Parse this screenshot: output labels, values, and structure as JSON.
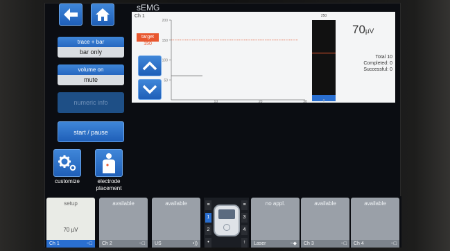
{
  "app": {
    "title": "sEMG"
  },
  "nav": {
    "back_icon": "back-arrow-icon",
    "home_icon": "home-icon"
  },
  "left": {
    "display_mode": {
      "option": "trace + bar",
      "value": "bar only"
    },
    "volume": {
      "option": "volume on",
      "value": "mute"
    },
    "numeric_info": "numeric info",
    "start_pause": "start / pause",
    "customize": "customize",
    "electrode_line1": "electrode",
    "electrode_line2": "placement"
  },
  "trace": {
    "channel": "Ch 1",
    "target_label": "target",
    "target_value": "150",
    "y_ticks": [
      "200",
      "150",
      "100",
      "50"
    ],
    "x_ticks": [
      "10",
      "20",
      "30"
    ],
    "bar_scale_top": "250",
    "bar_scale_bottom": "0"
  },
  "chart_data": {
    "type": "line",
    "series": [
      {
        "values": [
          60,
          60
        ]
      }
    ],
    "target": 150,
    "bar_level": 60,
    "ylim": [
      0,
      200
    ],
    "xlim": [
      0,
      30
    ]
  },
  "readout": {
    "value": "70",
    "unit": "µV",
    "total_label": "Total",
    "total": "10",
    "completed_label": "Completed:",
    "completed": "0",
    "successful_label": "Successful:",
    "successful": "0"
  },
  "channels": [
    {
      "top": "setup",
      "mid": "70 µV",
      "foot": "Ch 1"
    },
    {
      "top": "available",
      "foot": "Ch 2"
    },
    {
      "top": "available",
      "foot": "US"
    },
    {
      "top": "no appl.",
      "foot": "Laser"
    },
    {
      "top": "available",
      "foot": "Ch 3"
    },
    {
      "top": "available",
      "foot": "Ch 4"
    }
  ],
  "switch": {
    "left": [
      "1",
      "2"
    ],
    "right": [
      "3",
      "4"
    ]
  },
  "colors": {
    "accent": "#2f7ad0",
    "target": "#e8562e",
    "bar": "#2a6fd0"
  }
}
